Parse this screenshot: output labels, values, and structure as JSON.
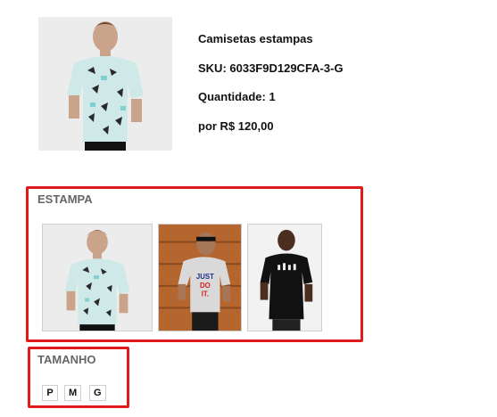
{
  "product": {
    "name": "Camisetas estampas",
    "sku": "SKU: 6033F9D129CFA-3-G",
    "quantity": "Quantidade: 1",
    "price": "por R$ 120,00"
  },
  "estampa": {
    "label": "ESTAMPA",
    "options": [
      {
        "name": "estampa-geometrica",
        "shirt_text": ""
      },
      {
        "name": "estampa-just-do-it",
        "shirt_text": "JUST DO IT."
      },
      {
        "name": "estampa-preta",
        "shirt_text": ""
      }
    ]
  },
  "tamanho": {
    "label": "TAMANHO",
    "sizes": [
      "P",
      "M",
      "G"
    ]
  },
  "colors": {
    "highlight_border": "#e11a1a",
    "label_gray": "#666666",
    "shirt_mint": "#cfe9e8",
    "shirt_gray": "#d9d9d9",
    "shirt_black": "#111111",
    "wood": "#b5652e"
  }
}
